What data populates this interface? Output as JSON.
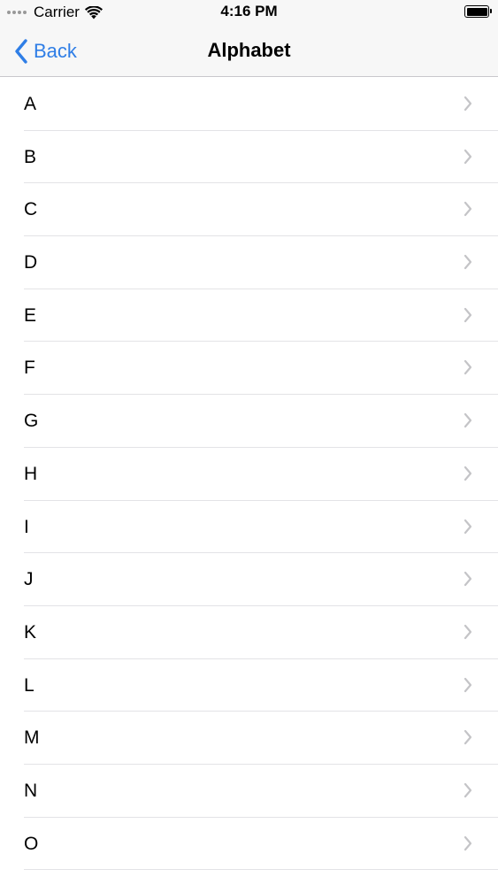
{
  "status_bar": {
    "carrier": "Carrier",
    "time": "4:16 PM",
    "signal_icon": "signal-dots-icon",
    "wifi_icon": "wifi-icon",
    "battery_icon": "battery-icon",
    "battery_level": 1.0
  },
  "nav": {
    "back_label": "Back",
    "back_icon": "chevron-left-icon",
    "title": "Alphabet",
    "accent_color": "#2f7ee6"
  },
  "list": {
    "row_icon": "chevron-right-icon",
    "items": [
      {
        "label": "A"
      },
      {
        "label": "B"
      },
      {
        "label": "C"
      },
      {
        "label": "D"
      },
      {
        "label": "E"
      },
      {
        "label": "F"
      },
      {
        "label": "G"
      },
      {
        "label": "H"
      },
      {
        "label": "I"
      },
      {
        "label": "J"
      },
      {
        "label": "K"
      },
      {
        "label": "L"
      },
      {
        "label": "M"
      },
      {
        "label": "N"
      },
      {
        "label": "O"
      }
    ]
  }
}
